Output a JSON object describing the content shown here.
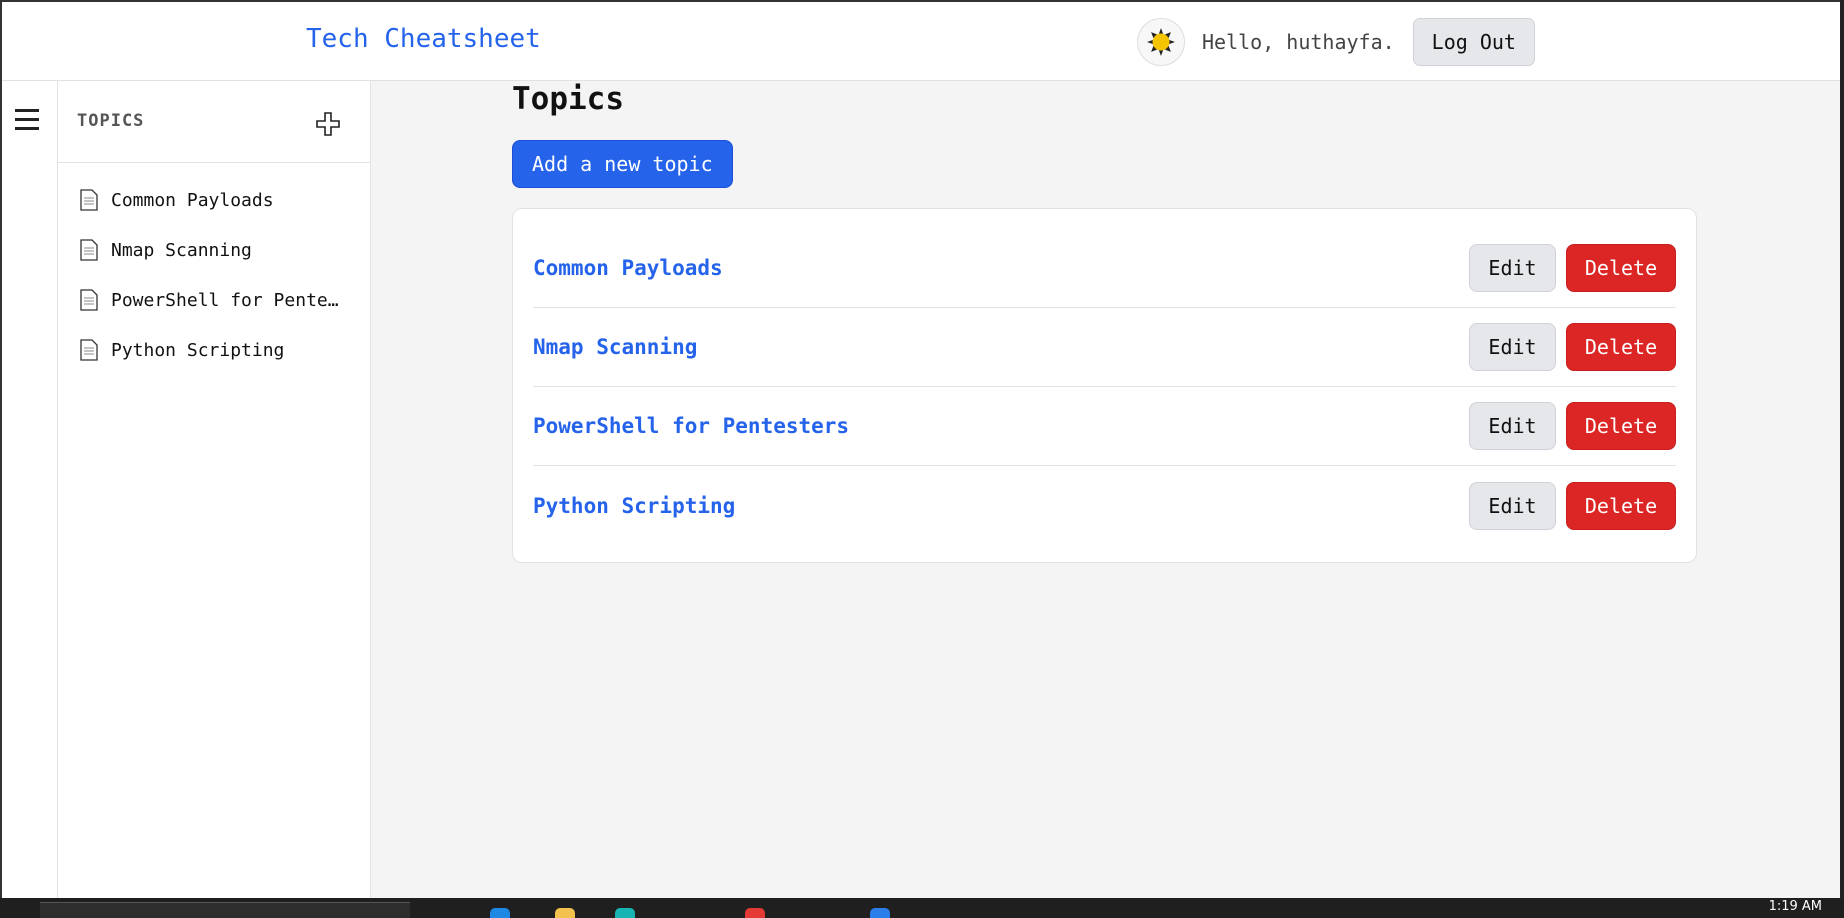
{
  "header": {
    "app_title": "Tech Cheatsheet",
    "greeting": "Hello, huthayfa.",
    "logout_label": "Log Out"
  },
  "sidebar": {
    "heading": "TOPICS",
    "items": [
      {
        "label": "Common Payloads"
      },
      {
        "label": "Nmap Scanning"
      },
      {
        "label": "PowerShell for Pentesters"
      },
      {
        "label": "Python Scripting"
      }
    ]
  },
  "main": {
    "title": "Topics",
    "add_topic_label": "Add a new topic",
    "topics": [
      {
        "name": "Common Payloads",
        "edit_label": "Edit",
        "delete_label": "Delete"
      },
      {
        "name": "Nmap Scanning",
        "edit_label": "Edit",
        "delete_label": "Delete"
      },
      {
        "name": "PowerShell for Pentesters",
        "edit_label": "Edit",
        "delete_label": "Delete"
      },
      {
        "name": "Python Scripting",
        "edit_label": "Edit",
        "delete_label": "Delete"
      }
    ]
  },
  "taskbar": {
    "clock": "1:19 AM"
  },
  "colors": {
    "accent": "#2563eb",
    "danger": "#dc2626",
    "background": "#f4f4f4"
  },
  "icons": {
    "menu": "hamburger-icon",
    "add": "plus-icon",
    "page": "document-icon",
    "avatar": "sun-icon"
  }
}
